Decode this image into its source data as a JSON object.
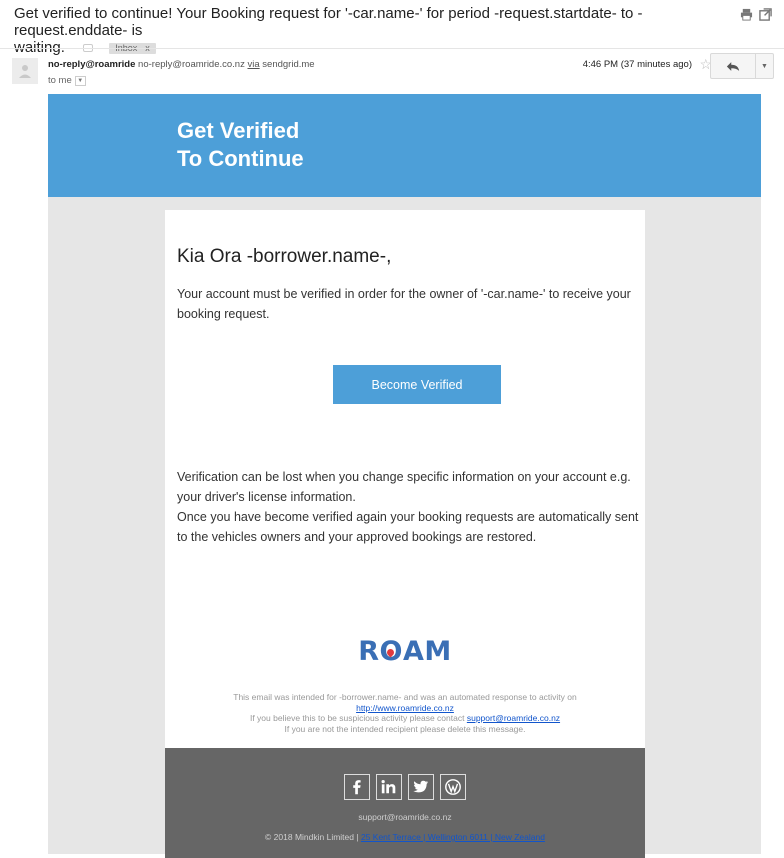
{
  "thread": {
    "subject_line1": "Get verified to continue! Your Booking request for '-car.name-' for period -request.startdate- to -request.enddate- is",
    "subject_line2": "waiting.",
    "label": "Inbox",
    "label_close": "x"
  },
  "message": {
    "sender_name": "no-reply@roamride",
    "sender_email": "no-reply@roamride.co.nz",
    "via_label": "via",
    "via_domain": "sendgrid.me",
    "to": "to me",
    "timestamp": "4:46 PM (37 minutes ago)"
  },
  "email": {
    "hero_title_line1": "Get Verified",
    "hero_title_line2": "To Continue",
    "greeting": "Kia Ora -borrower.name-,",
    "intro": "Your account must be verified in order for the owner of '-car.name-' to receive your booking request.",
    "cta_label": "Become Verified",
    "body_para1": "Verification can be lost when you change specific information on your account e.g. your driver's license information.",
    "body_para2": "Once you have become verified again your booking requests are automatically sent to the vehicles owners and your approved bookings are restored.",
    "logo_text": "ROAM",
    "disclaimer_line1": "This email was intended for -borrower.name- and was an automated response to activity on",
    "disclaimer_link": "http://www.roamride.co.nz",
    "disclaimer_line3_prefix": "If you believe this to be suspicious activity please contact",
    "support_email_link": "support@roamride.co.nz",
    "disclaimer_line4": "If you are not the intended recipient please delete this message.",
    "footer_email": "support@roamride.co.nz",
    "footer_copyright": "© 2018 Mindkin Limited |",
    "footer_address": "25 Kent Terrace | Wellington 6011 | New Zealand",
    "social_icons": [
      "facebook-icon",
      "linkedin-icon",
      "twitter-icon",
      "wordpress-icon"
    ]
  },
  "colors": {
    "brand_blue": "#4d9fd8",
    "logo_blue": "#3a6fb5",
    "logo_red": "#e03a3e",
    "footer_gray": "#666666",
    "frame_gray": "#e6e6e6"
  }
}
